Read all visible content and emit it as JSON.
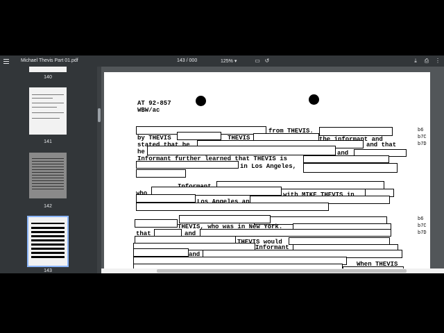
{
  "toolbar": {
    "title": "Michael Thevis Part 01.pdf",
    "page_current": "143",
    "page_total": "000",
    "zoom": "125%",
    "menu_icon": "menu-icon",
    "download_icon": "download-icon",
    "print_icon": "print-icon",
    "more_icon": "more-icon"
  },
  "thumbnails": [
    {
      "label": "140"
    },
    {
      "label": "141"
    },
    {
      "label": "142"
    },
    {
      "label": "143"
    }
  ],
  "document": {
    "file_no": "AT 92-857",
    "initials": "WBW/ac",
    "lines": [
      "from THEVIS.",
      "by THEVIS",
      "THEVIS",
      "the informant and",
      "stated that he",
      "and that",
      "he",
      "and",
      "Informant further learned that THEVIS is",
      "in Los Angeles,",
      "Informant",
      "who",
      "with MIKE THEVIS in",
      "Los Angeles and THEVIS had",
      "THEVIS, who was in New York.",
      "that",
      "and",
      "THEVIS would",
      "Informant",
      "and",
      "When THEVIS"
    ],
    "exemptions_1": [
      "b6",
      "b7C",
      "b7D"
    ],
    "exemptions_2": [
      "b6",
      "b7C",
      "b7D"
    ]
  }
}
